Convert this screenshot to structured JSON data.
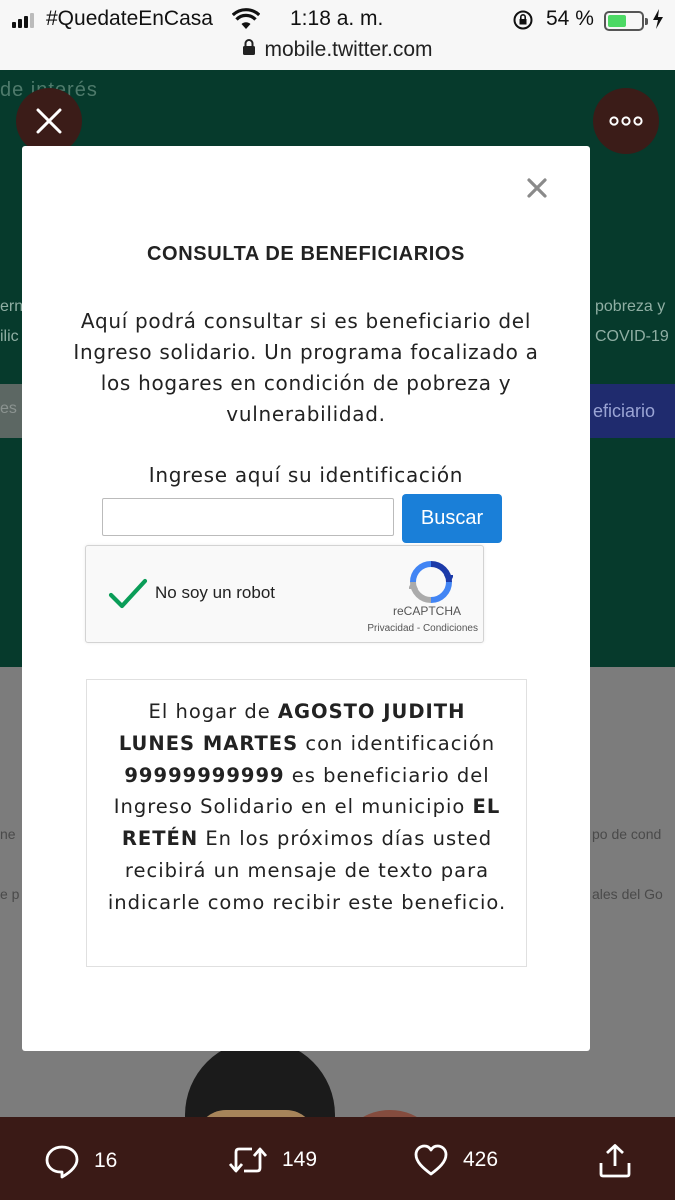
{
  "status_bar": {
    "carrier": "#QuedateEnCasa",
    "time": "1:18 a. m.",
    "battery_percent": "54 %",
    "battery_level": 0.54,
    "url": "mobile.twitter.com"
  },
  "background": {
    "interest_text": "de interés",
    "edge_left_1": "ern",
    "edge_left_2": "ilic",
    "edge_right_1": "pobreza y",
    "edge_right_2": "COVID-19",
    "blue_button_fragment": "eficiario",
    "gray_fragment": "es",
    "edge_left_3": "ne",
    "edge_left_4": "e p",
    "edge_right_3": "po de cond",
    "edge_right_4": "ales del Go"
  },
  "modal": {
    "title": "CONSULTA DE BENEFICIARIOS",
    "description": "Aquí podrá consultar si es beneficiario del Ingreso solidario. Un programa focalizado a los hogares en condición de pobreza y vulnerabilidad.",
    "id_label": "Ingrese aquí su identificación",
    "id_input_value": "",
    "search_button": "Buscar",
    "captcha": {
      "label": "No soy un robot",
      "brand": "reCAPTCHA",
      "links": "Privacidad - Condiciones"
    },
    "result": {
      "t1": "El hogar de ",
      "name": "AGOSTO JUDITH LUNES MARTES",
      "t2": " con identificación ",
      "id": "99999999999",
      "t3": " es beneficiario del Ingreso Solidario en el municipio ",
      "municipio": "EL RETÉN",
      "t4": " En los próximos días usted recibirá un mensaje de texto para indicarle como recibir este beneficio."
    }
  },
  "actions": {
    "replies": "16",
    "retweets": "149",
    "likes": "426"
  },
  "colors": {
    "accent_blue": "#1a7fd8",
    "check_green": "#0a9d58",
    "header_green": "#063a2c",
    "bar_brown": "#3a1a16"
  }
}
